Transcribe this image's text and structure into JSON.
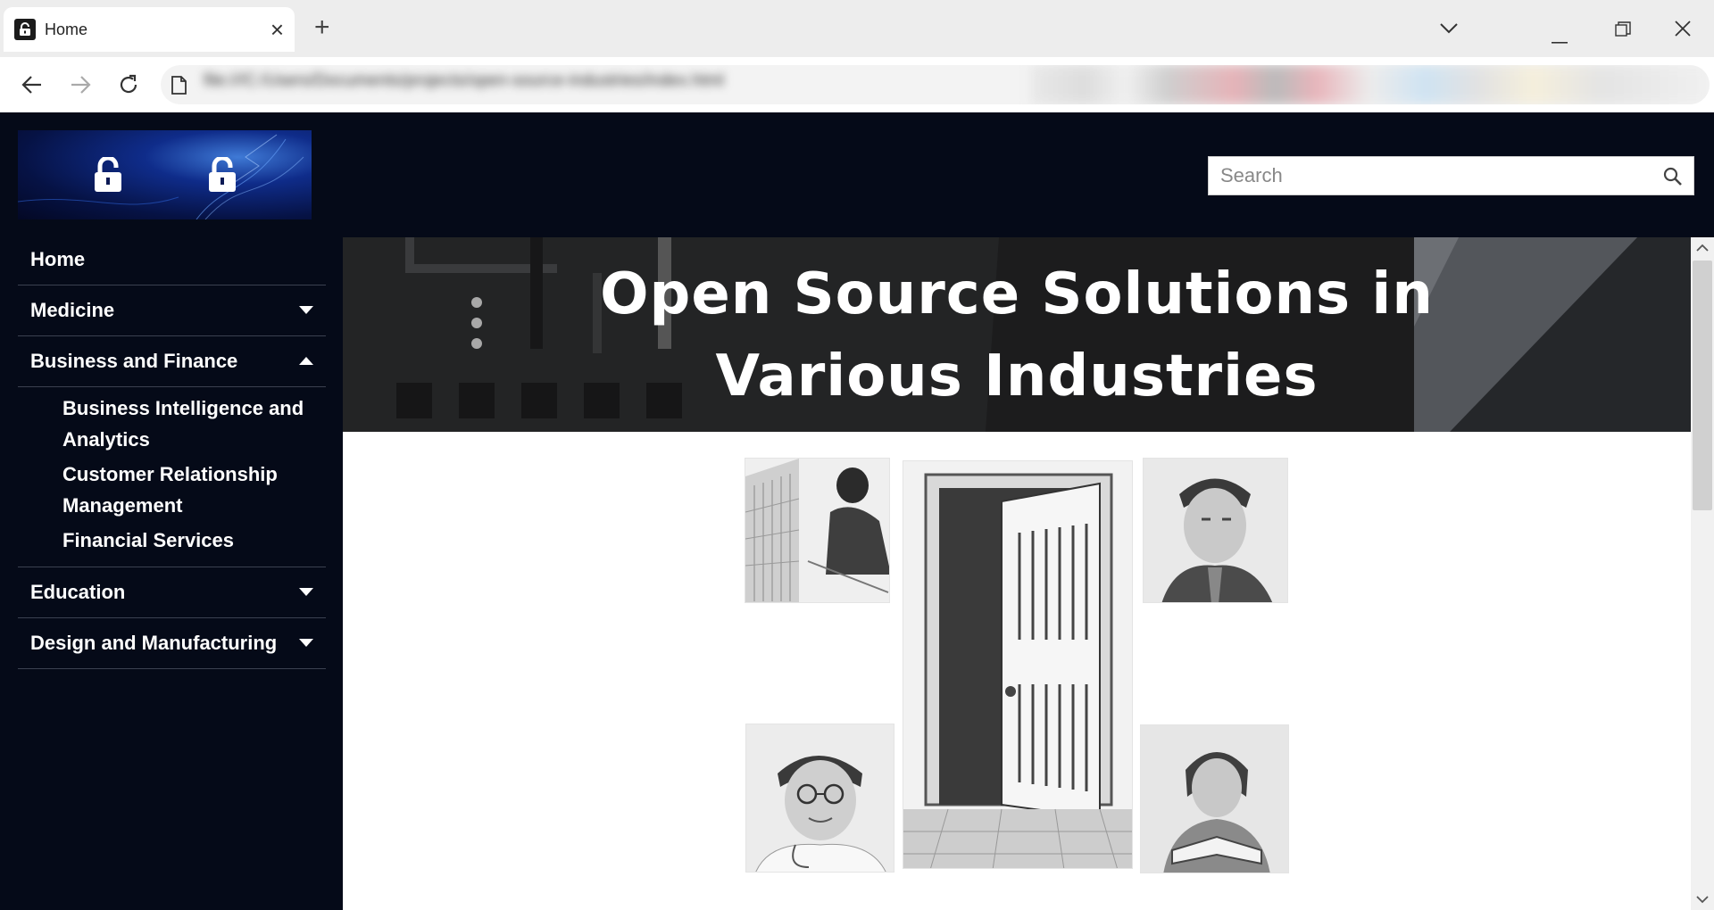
{
  "browser": {
    "tab_title": "Home",
    "url": "file:///C:/Users/Documents/projects/open-source-industries/index.html"
  },
  "search": {
    "placeholder": "Search"
  },
  "sidebar": {
    "items": [
      {
        "label": "Home"
      },
      {
        "label": "Medicine"
      },
      {
        "label": "Business and Finance",
        "children": [
          {
            "label": "Business Intelligence and Analytics"
          },
          {
            "label": "Customer Relationship Management"
          },
          {
            "label": "Financial Services"
          }
        ]
      },
      {
        "label": "Education"
      },
      {
        "label": "Design and Manufacturing"
      }
    ]
  },
  "banner": {
    "line1": "Open Source Solutions in",
    "line2": "Various Industries"
  },
  "colors": {
    "page_background": "#050a18",
    "banner_background": "#232425",
    "accent_white": "#ffffff"
  }
}
